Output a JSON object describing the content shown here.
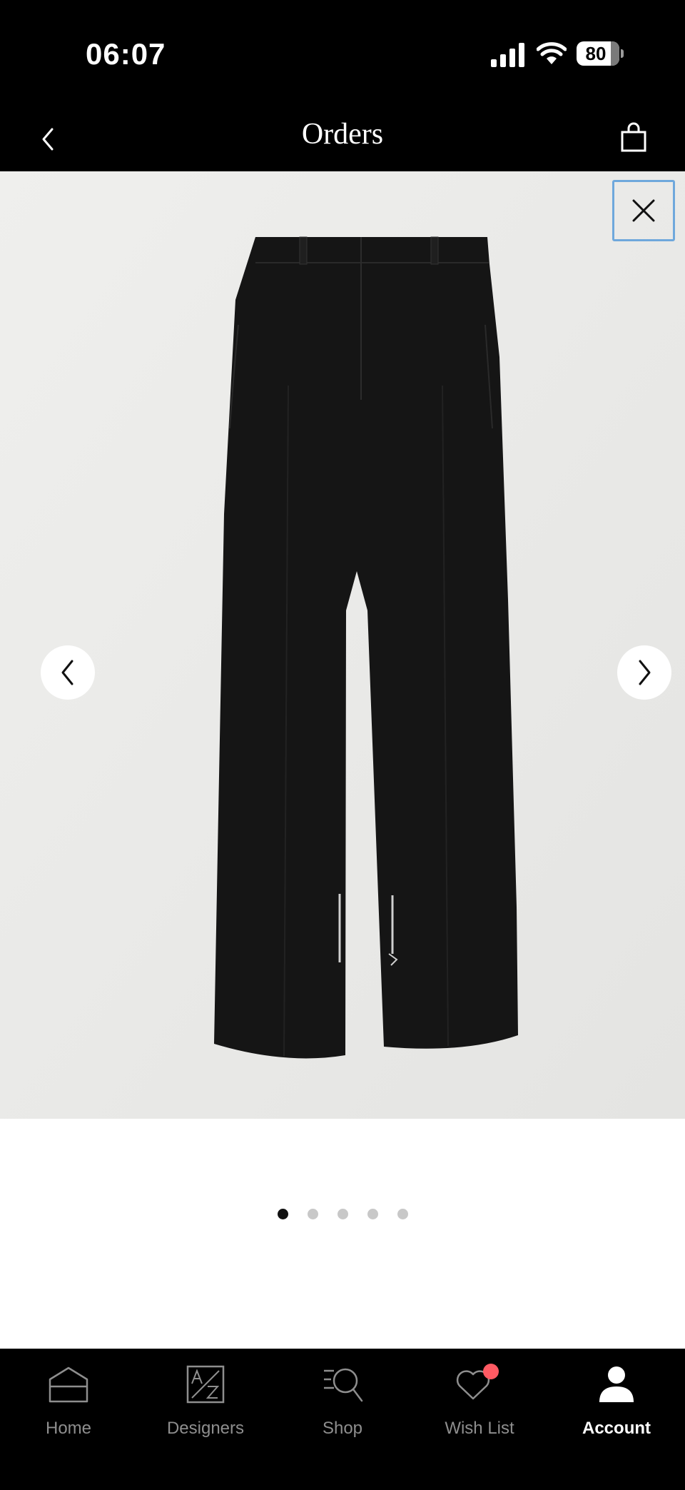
{
  "status_bar": {
    "time": "06:07",
    "battery": "80",
    "icons": [
      "cellular-signal-icon",
      "wifi-icon",
      "battery-icon"
    ]
  },
  "header": {
    "title": "Orders",
    "back_icon": "chevron-left-icon",
    "bag_icon": "shopping-bag-icon"
  },
  "gallery": {
    "close_icon": "close-icon",
    "prev_icon": "chevron-left-icon",
    "next_icon": "chevron-right-icon",
    "image": "black-wide-leg-trousers",
    "current_index": 1,
    "total_images": 5
  },
  "tabbar": {
    "tabs": [
      {
        "label": "Home",
        "icon": "home-icon",
        "active": false
      },
      {
        "label": "Designers",
        "icon": "designers-az-icon",
        "active": false
      },
      {
        "label": "Shop",
        "icon": "shop-search-icon",
        "active": false
      },
      {
        "label": "Wish List",
        "icon": "heart-icon",
        "active": false,
        "badge": true
      },
      {
        "label": "Account",
        "icon": "account-icon",
        "active": true
      }
    ]
  },
  "colors": {
    "bar_background": "#000000",
    "gallery_background": "#ebebe9",
    "focus_outline": "#6fa8dc",
    "badge": "#ff5a63",
    "inactive_tab": "#8e8e8e"
  }
}
